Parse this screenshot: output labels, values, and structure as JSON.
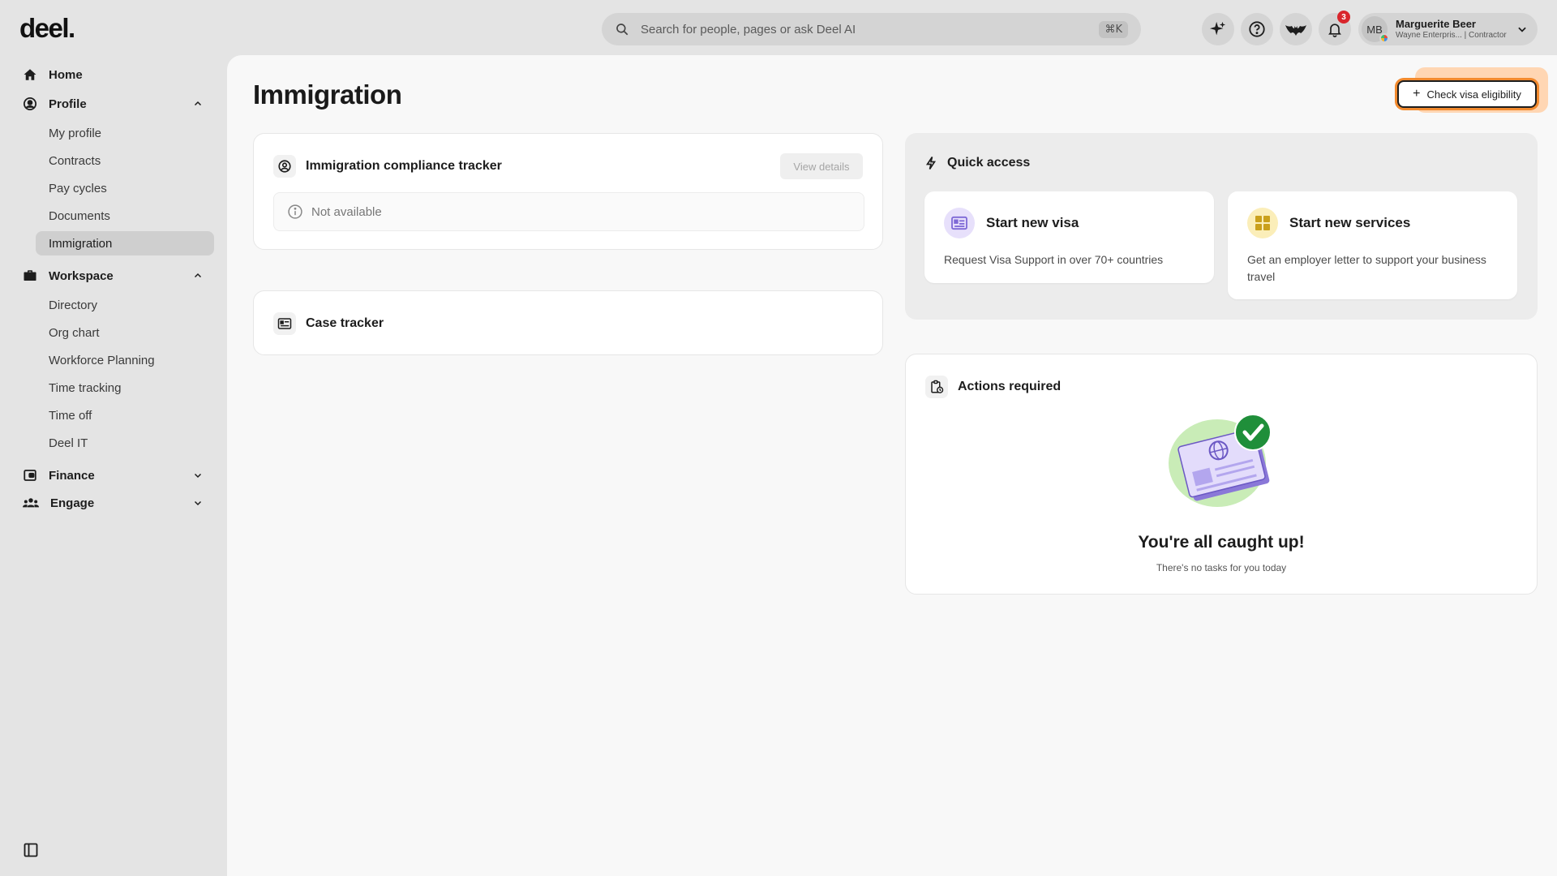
{
  "app": {
    "logo": "deel."
  },
  "search": {
    "placeholder": "Search for people, pages or ask Deel AI",
    "shortcut": "⌘K"
  },
  "topbar": {
    "notification_count": "3"
  },
  "user": {
    "initials": "MB",
    "name": "Marguerite Beer",
    "subtitle": "Wayne Enterpris... | Contractor"
  },
  "sidebar": {
    "home": "Home",
    "profile": {
      "label": "Profile",
      "items": [
        "My profile",
        "Contracts",
        "Pay cycles",
        "Documents",
        "Immigration"
      ]
    },
    "workspace": {
      "label": "Workspace",
      "items": [
        "Directory",
        "Org chart",
        "Workforce Planning",
        "Time tracking",
        "Time off",
        "Deel IT"
      ]
    },
    "finance": "Finance",
    "engage": "Engage"
  },
  "main": {
    "title": "Immigration",
    "cta": "Check visa eligibility",
    "compliance": {
      "title": "Immigration compliance tracker",
      "button": "View details",
      "status": "Not available"
    },
    "case_tracker": {
      "title": "Case tracker"
    },
    "quick_access": {
      "title": "Quick access",
      "visa": {
        "title": "Start new visa",
        "desc": "Request Visa Support in over 70+ countries"
      },
      "services": {
        "title": "Start new services",
        "desc": "Get an employer letter to support your business travel"
      }
    },
    "actions": {
      "title": "Actions required",
      "empty_title": "You're all caught up!",
      "empty_sub": "There's no tasks for you today"
    }
  },
  "colors": {
    "accent_orange": "#f28a2e",
    "badge_red": "#d9262c",
    "visa_purple": "#7e69d6",
    "services_yellow": "#f5c94a",
    "success_green": "#1f8f3a"
  }
}
